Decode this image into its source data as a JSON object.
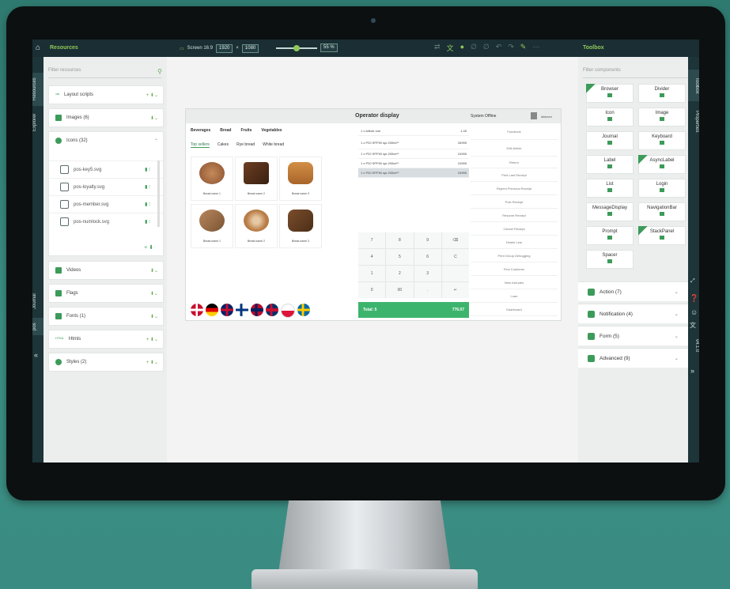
{
  "topbar": {
    "left_title": "Resources",
    "screen_label": "Screen 16:9",
    "width": "1920",
    "height": "1080",
    "zoom": "55 %",
    "right_title": "Toolbox"
  },
  "rails": {
    "left_top": "Resources",
    "left_mid": "Explorer",
    "left_low": "Journal",
    "left_bottom": "pos",
    "right_top": "Toolbox",
    "right_mid": "Properties",
    "right_ver": "v4.1.0"
  },
  "resources": {
    "filter_placeholder": "Filter resources",
    "sections": [
      {
        "label": "Layout scripts"
      },
      {
        "label": "Images (6)"
      },
      {
        "label": "Icons (32)"
      },
      {
        "label": "Videos"
      },
      {
        "label": "Flags"
      },
      {
        "label": "Fonts (1)"
      },
      {
        "label": "Htmls"
      },
      {
        "label": "Styles (2)"
      }
    ],
    "files": [
      "pos-key5.svg",
      "pos-loyalty.svg",
      "pos-member.svg",
      "pos-numlock.svg"
    ]
  },
  "operator": {
    "title": "Operator display",
    "offline": "System Offline",
    "user": "lalarsen",
    "categories": [
      "Beverages",
      "Bread",
      "Fruits",
      "Vegetables"
    ],
    "subtabs": [
      "Top sellers",
      "Cakes",
      "Rye bread",
      "White bread"
    ],
    "products": [
      "Bread name 1",
      "Bread name 2",
      "Bread name 3",
      "Bread name 1",
      "Bread name 2",
      "Bread name 3"
    ],
    "receipt": [
      [
        "1 x Article one",
        "1.45"
      ],
      [
        "1 x P20 SPF50 spr.200ml**",
        "34995"
      ],
      [
        "1 x P20 SPF50 spr.200ml**",
        "24995"
      ],
      [
        "1 x P20 SPF50 spr.200ml**",
        "24995"
      ],
      [
        "1 x P20 SPF50 spr.200ml**",
        "24995"
      ]
    ],
    "keys": [
      "7",
      "8",
      "9",
      "⌫",
      "4",
      "5",
      "6",
      "C",
      "1",
      "2",
      "3",
      "",
      "0",
      "00",
      ".",
      "↵"
    ],
    "total_label": "Total: 5",
    "total_value": "776.07",
    "functions": [
      "Functions",
      "Edit Article",
      "Return",
      "Print Last Receipt",
      "Reprint Previous Receipt",
      "Pole Receipt",
      "Resume Receipt",
      "Cancel Receipt",
      "Delete Line",
      "Print Group Debugging",
      "Find Customer",
      "New Includes",
      "Loan",
      "Dashboard"
    ]
  },
  "toolbox": {
    "filter_placeholder": "Filter components",
    "components": [
      "Browser",
      "Divider",
      "Icon",
      "Image",
      "Journal",
      "Keyboard",
      "Label",
      "AsyncLabel",
      "List",
      "Login",
      "MessageDisplay",
      "NavigationBar",
      "Prompt",
      "StackPanel",
      "Spacer"
    ],
    "groups": [
      "Action (7)",
      "Notification (4)",
      "Form (5)",
      "Advanced (9)"
    ]
  }
}
